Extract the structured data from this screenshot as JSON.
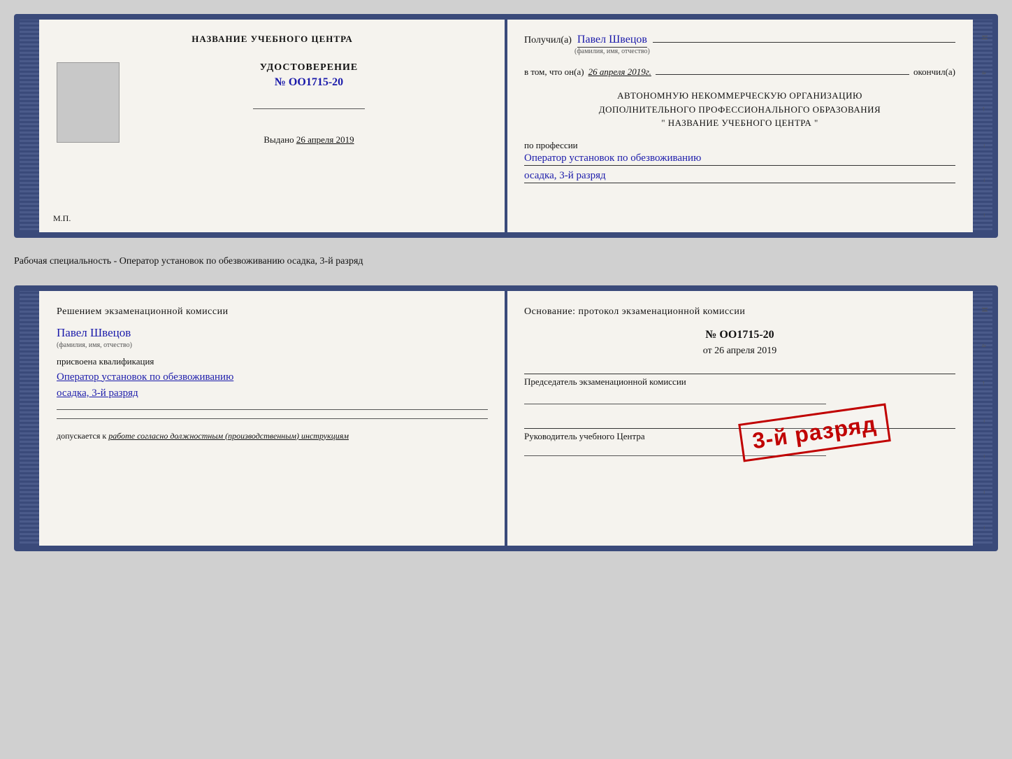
{
  "top_doc": {
    "left": {
      "header": "НАЗВАНИЕ УЧЕБНОГО ЦЕНТРА",
      "cert_title": "УДОСТОВЕРЕНИЕ",
      "cert_number": "№ OO1715-20",
      "issued_label": "Выдано",
      "issued_date": "26 апреля 2019",
      "mp_label": "М.П."
    },
    "right": {
      "received_label": "Получил(а)",
      "received_name": "Павел Швецов",
      "name_subtitle": "(фамилия, имя, отчество)",
      "vtom_label": "в том, что он(а)",
      "vtom_date": "26 апреля 2019г.",
      "okonchil_label": "окончил(а)",
      "org_line1": "АВТОНОМНУЮ НЕКОММЕРЧЕСКУЮ ОРГАНИЗАЦИЮ",
      "org_line2": "ДОПОЛНИТЕЛЬНОГО ПРОФЕССИОНАЛЬНОГО ОБРАЗОВАНИЯ",
      "org_line3": "\" НАЗВАНИЕ УЧЕБНОГО ЦЕНТРА \"",
      "profession_label": "по профессии",
      "profession_value": "Оператор установок по обезвоживанию",
      "rank_value": "осадка, 3-й разряд"
    }
  },
  "separator": {
    "text": "Рабочая специальность - Оператор установок по обезвоживанию осадка, 3-й разряд"
  },
  "bottom_doc": {
    "left": {
      "commission_text": "Решением экзаменационной комиссии",
      "person_name": "Павел Швецов",
      "name_subtitle": "(фамилия, имя, отчество)",
      "assigned_label": "присвоена квалификация",
      "qualification1": "Оператор установок по обезвоживанию",
      "qualification2": "осадка, 3-й разряд",
      "line1": "",
      "line2": "",
      "allowed_label": "допускается к",
      "allowed_value": "работе согласно должностным (производственным) инструкциям"
    },
    "right": {
      "basis_title": "Основание: протокол экзаменационной комиссии",
      "protocol_number": "№ OO1715-20",
      "protocol_date_prefix": "от",
      "protocol_date": "26 апреля 2019",
      "chairman_label": "Председатель экзаменационной комиссии",
      "stamp_text": "3-й разряд",
      "director_label": "Руководитель учебного Центра"
    }
  },
  "side_marks": {
    "marks": [
      "И",
      "а",
      "←",
      "–",
      "–",
      "–",
      "–"
    ]
  }
}
